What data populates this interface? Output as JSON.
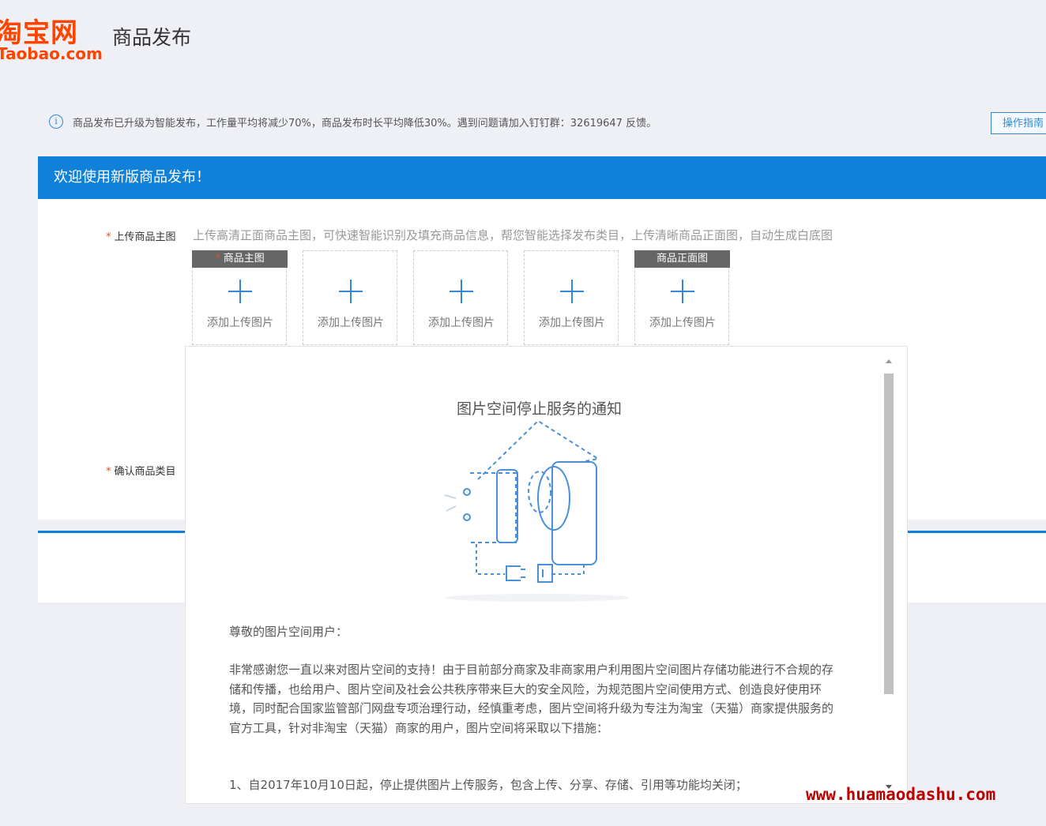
{
  "header": {
    "logo_cn": "淘宝网",
    "logo_en": "Taobao.com",
    "page_title": "商品发布"
  },
  "notice": {
    "text": "商品发布已升级为智能发布，工作量平均将减少70%，商品发布时长平均降低30%。遇到问题请加入钉钉群：32619647 反馈。",
    "guide_button": "操作指南"
  },
  "banner": {
    "title": "欢迎使用新版商品发布！"
  },
  "form": {
    "main_image_label": "上传商品主图",
    "main_image_hint": "上传高清正面商品主图，可快速智能识别及填充商品信息，帮您智能选择发布类目，上传清晰商品正面图，自动生成白底图",
    "category_label": "确认商品类目",
    "slots": [
      {
        "tag": "商品主图",
        "required": true,
        "label": "添加上传图片"
      },
      {
        "tag": "",
        "required": false,
        "label": "添加上传图片"
      },
      {
        "tag": "",
        "required": false,
        "label": "添加上传图片"
      },
      {
        "tag": "",
        "required": false,
        "label": "添加上传图片"
      },
      {
        "tag": "商品正面图",
        "required": false,
        "label": "添加上传图片"
      }
    ]
  },
  "modal": {
    "title": "图片空间停止服务的通知",
    "greeting": "尊敬的图片空间用户：",
    "paragraph": "非常感谢您一直以来对图片空间的支持！由于目前部分商家及非商家用户利用图片空间图片存储功能进行不合规的存储和传播，也给用户、图片空间及社会公共秩序带来巨大的安全风险，为规范图片空间使用方式、创造良好使用环境，同时配合国家监管部门网盘专项治理行动，经慎重考虑，图片空间将升级为专注为淘宝（天猫）商家提供服务的官方工具，针对非淘宝（天猫）商家的用户，图片空间将采取以下措施：",
    "item1": "1、自2017年10月10日起，停止提供图片上传服务，包含上传、分享、存储、引用等功能均关闭；"
  },
  "watermark": "www.huamaodashu.com",
  "colors": {
    "brand": "#ff4400",
    "primary": "#1080d8"
  }
}
